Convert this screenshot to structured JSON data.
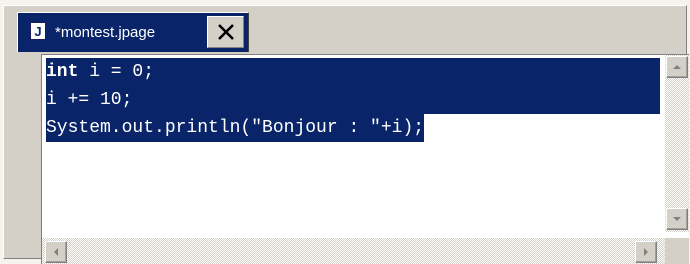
{
  "tab": {
    "title": "*montest.jpage",
    "icon_letter": "J",
    "icon": "java-file-icon",
    "close_icon": "close-icon"
  },
  "editor": {
    "lines": [
      {
        "keyword": "int",
        "rest": " i = 0;"
      },
      {
        "text": "i += 10;"
      },
      {
        "text": "System.out.println(\"Bonjour : \"+i);"
      }
    ],
    "selection_color": "#0a246a"
  }
}
